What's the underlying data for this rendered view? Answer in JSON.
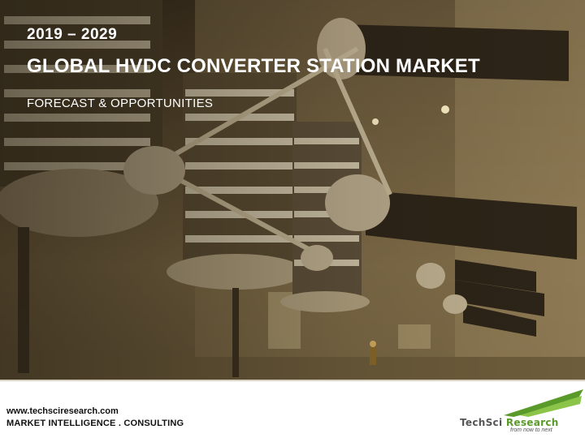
{
  "header": {
    "years": "2019 – 2029",
    "title": "GLOBAL HVDC CONVERTER STATION MARKET",
    "subtitle": "FORECAST & OPPORTUNITIES"
  },
  "footer": {
    "url": "www.techsciresearch.com",
    "tagline": "MARKET INTELLIGENCE . CONSULTING"
  },
  "logo": {
    "name_part1": "TechSci ",
    "name_part2": "Research",
    "slogan": "from now to next"
  },
  "colors": {
    "brand_green": "#5a9a2a",
    "photo_tone": "#7a6744"
  }
}
